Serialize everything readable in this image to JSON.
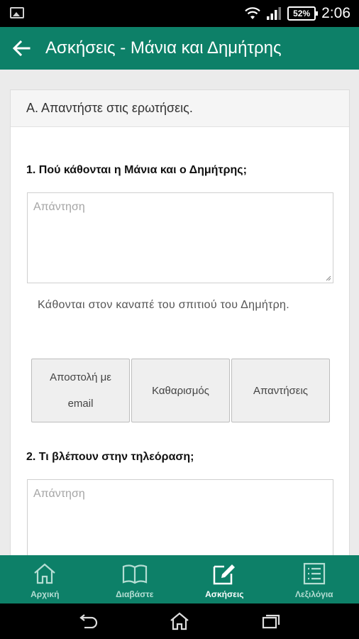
{
  "status_bar": {
    "battery": "52%",
    "time": "2:06",
    "icons": [
      "gallery-icon",
      "wifi-icon",
      "signal-icon",
      "battery-icon"
    ]
  },
  "app_bar": {
    "title": "Ασκήσεις - Μάνια και Δημήτρης",
    "back_icon": "arrow-left-icon"
  },
  "card": {
    "header": "Α. Απαντήστε στις ερωτήσεις.",
    "questions": [
      {
        "label": "1. Πού κάθονται η Μάνια και ο Δημήτρης;",
        "placeholder": "Απάντηση",
        "answer": "Κάθονται στον καναπέ του σπιτιού του Δημήτρη."
      },
      {
        "label": "2. Τι βλέπουν στην τηλεόραση;",
        "placeholder": "Απάντηση"
      }
    ],
    "buttons": {
      "email": "Αποστολή με email",
      "clear": "Καθαρισμός",
      "answers": "Απαντήσεις"
    }
  },
  "bottom_nav": {
    "items": [
      {
        "label": "Αρχική",
        "icon": "home-icon",
        "active": false
      },
      {
        "label": "Διαβάστε",
        "icon": "book-icon",
        "active": false
      },
      {
        "label": "Ασκήσεις",
        "icon": "edit-icon",
        "active": true
      },
      {
        "label": "Λεξιλόγια",
        "icon": "list-icon",
        "active": false
      }
    ]
  },
  "colors": {
    "primary": "#0d8068",
    "nav_inactive": "#b4ddd3"
  }
}
